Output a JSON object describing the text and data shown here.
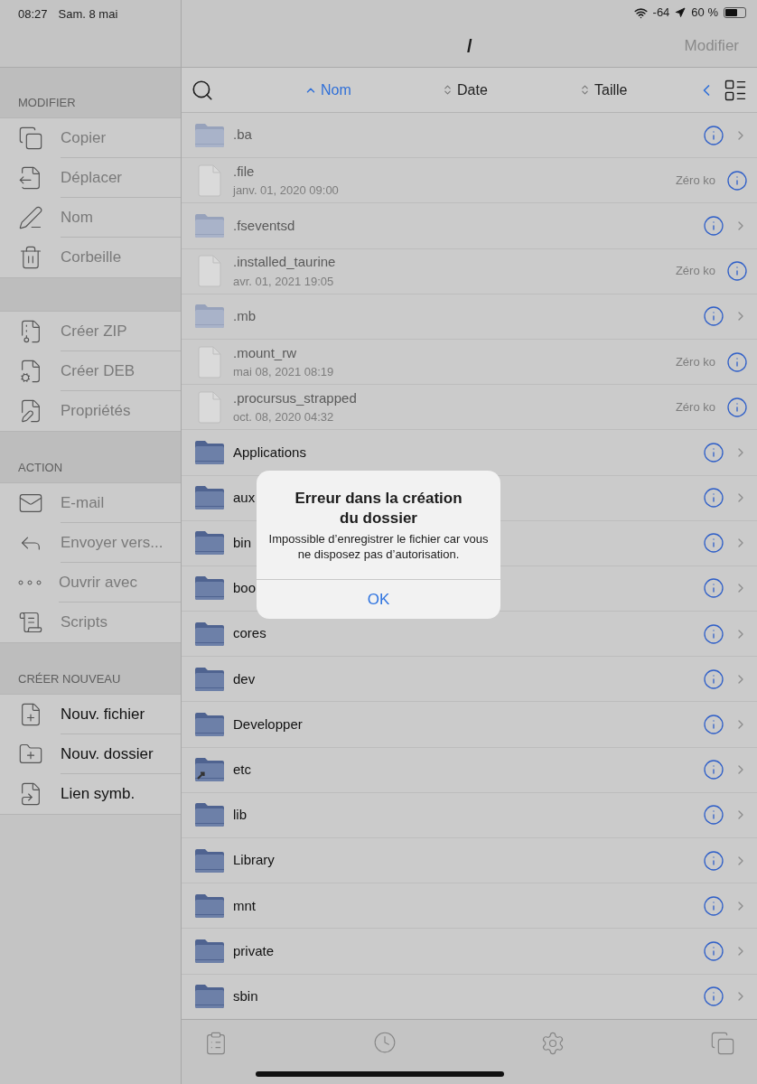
{
  "status_bar": {
    "time": "08:27",
    "date": "Sam. 8 mai",
    "signal": "-64",
    "battery": "60 %",
    "level": 0.6
  },
  "header": {
    "title": "/",
    "edit": "Modifier"
  },
  "sidebar": {
    "sections": [
      {
        "title": "MODIFIER",
        "items": [
          {
            "kind": "copy",
            "label": "Copier",
            "disabled": true
          },
          {
            "kind": "move",
            "label": "Déplacer",
            "disabled": true
          },
          {
            "kind": "rename",
            "label": "Nom",
            "disabled": true
          },
          {
            "kind": "trash",
            "label": "Corbeille",
            "disabled": true
          }
        ]
      },
      {
        "items": [
          {
            "kind": "zip",
            "label": "Créer ZIP",
            "disabled": true
          },
          {
            "kind": "deb",
            "label": "Créer DEB",
            "disabled": true
          },
          {
            "kind": "props",
            "label": "Propriétés",
            "disabled": true
          }
        ]
      },
      {
        "title": "ACTION",
        "items": [
          {
            "kind": "mail",
            "label": "E-mail",
            "disabled": true
          },
          {
            "kind": "send",
            "label": "Envoyer vers...",
            "disabled": true
          },
          {
            "kind": "open",
            "label": "Ouvrir avec",
            "disabled": true
          },
          {
            "kind": "scripts",
            "label": "Scripts",
            "disabled": true
          }
        ]
      },
      {
        "title": "CRÉER NOUVEAU",
        "items": [
          {
            "kind": "newfile",
            "label": "Nouv. fichier",
            "disabled": false
          },
          {
            "kind": "newfolder",
            "label": "Nouv. dossier",
            "disabled": false
          },
          {
            "kind": "link",
            "label": "Lien symb.",
            "disabled": false
          }
        ]
      }
    ]
  },
  "sort": [
    {
      "label": "Nom",
      "selected": true
    },
    {
      "label": "Date",
      "selected": false
    },
    {
      "label": "Taille",
      "selected": false
    }
  ],
  "files": [
    {
      "kind": "folder",
      "name": ".ba",
      "hidden": true
    },
    {
      "kind": "file",
      "name": ".file",
      "date": "janv. 01, 2020 09:00",
      "size": "Zéro ko"
    },
    {
      "kind": "folder",
      "name": ".fseventsd",
      "hidden": true
    },
    {
      "kind": "file",
      "name": ".installed_taurine",
      "date": "avr. 01, 2021 19:05",
      "size": "Zéro ko"
    },
    {
      "kind": "folder",
      "name": ".mb",
      "hidden": true
    },
    {
      "kind": "file",
      "name": ".mount_rw",
      "date": "mai 08, 2021 08:19",
      "size": "Zéro ko"
    },
    {
      "kind": "file",
      "name": ".procursus_strapped",
      "date": "oct. 08, 2020 04:32",
      "size": "Zéro ko"
    },
    {
      "kind": "folder",
      "name": "Applications",
      "hidden": false
    },
    {
      "kind": "folder",
      "name": "aux",
      "hidden": false
    },
    {
      "kind": "folder",
      "name": "bin",
      "hidden": false
    },
    {
      "kind": "folder",
      "name": "boo",
      "hidden": false
    },
    {
      "kind": "folder",
      "name": "cores",
      "hidden": false
    },
    {
      "kind": "folder",
      "name": "dev",
      "hidden": false
    },
    {
      "kind": "folder",
      "name": "Developper",
      "hidden": false
    },
    {
      "kind": "link",
      "name": "etc",
      "hidden": false
    },
    {
      "kind": "folder",
      "name": "lib",
      "hidden": false
    },
    {
      "kind": "folder",
      "name": "Library",
      "hidden": false
    },
    {
      "kind": "folder",
      "name": "mnt",
      "hidden": false
    },
    {
      "kind": "folder",
      "name": "private",
      "hidden": false
    },
    {
      "kind": "folder",
      "name": "sbin",
      "hidden": false
    }
  ],
  "alert": {
    "title": "Erreur dans la création du dossier",
    "message": "Impossible d’enregistrer le fichier car vous ne disposez pas d’autorisation.",
    "button": "OK"
  }
}
